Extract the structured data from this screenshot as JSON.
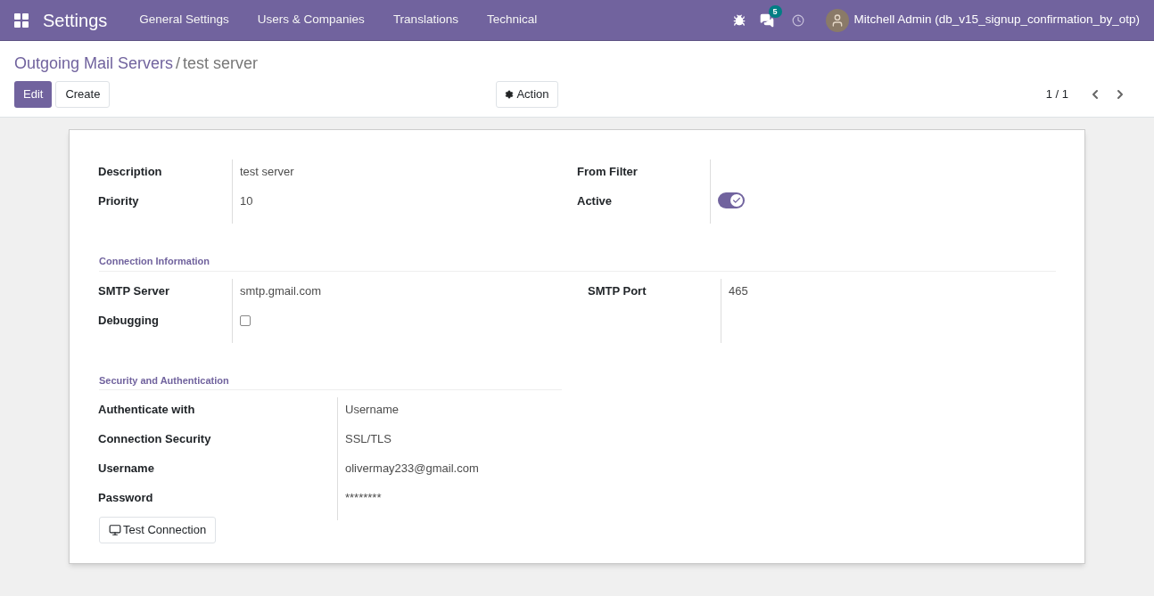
{
  "navbar": {
    "app_title": "Settings",
    "menu": [
      "General Settings",
      "Users & Companies",
      "Translations",
      "Technical"
    ],
    "messages_badge": "5",
    "user_name": "Mitchell Admin (db_v15_signup_confirmation_by_otp)"
  },
  "breadcrumb": {
    "parent": "Outgoing Mail Servers",
    "separator": "/",
    "current": "test server"
  },
  "buttons": {
    "edit": "Edit",
    "create": "Create",
    "action": "Action"
  },
  "pager": "1 / 1",
  "top_left": [
    {
      "label": "Description",
      "kind": "text",
      "value": "test server"
    },
    {
      "label": "Priority",
      "kind": "text",
      "value": "10"
    }
  ],
  "top_right": [
    {
      "label": "From Filter",
      "kind": "text"
    },
    {
      "label": "Active",
      "kind": "toggle",
      "on": true
    }
  ],
  "connection": {
    "title": "Connection Information",
    "left": [
      {
        "label": "SMTP Server",
        "kind": "text",
        "value": "smtp.gmail.com"
      },
      {
        "label": "Debugging",
        "kind": "checkbox",
        "checked": false
      }
    ],
    "right": [
      {
        "label": "SMTP Port",
        "kind": "text",
        "value": "465"
      }
    ]
  },
  "security": {
    "title": "Security and Authentication",
    "fields": [
      {
        "label": "Authenticate with",
        "kind": "text",
        "value": "Username"
      },
      {
        "label": "Connection Security",
        "kind": "text",
        "value": "SSL/TLS"
      },
      {
        "label": "Username",
        "kind": "text",
        "value": "olivermay233@gmail.com"
      },
      {
        "label": "Password",
        "kind": "text",
        "value": "********"
      }
    ],
    "test_button": "Test Connection"
  }
}
